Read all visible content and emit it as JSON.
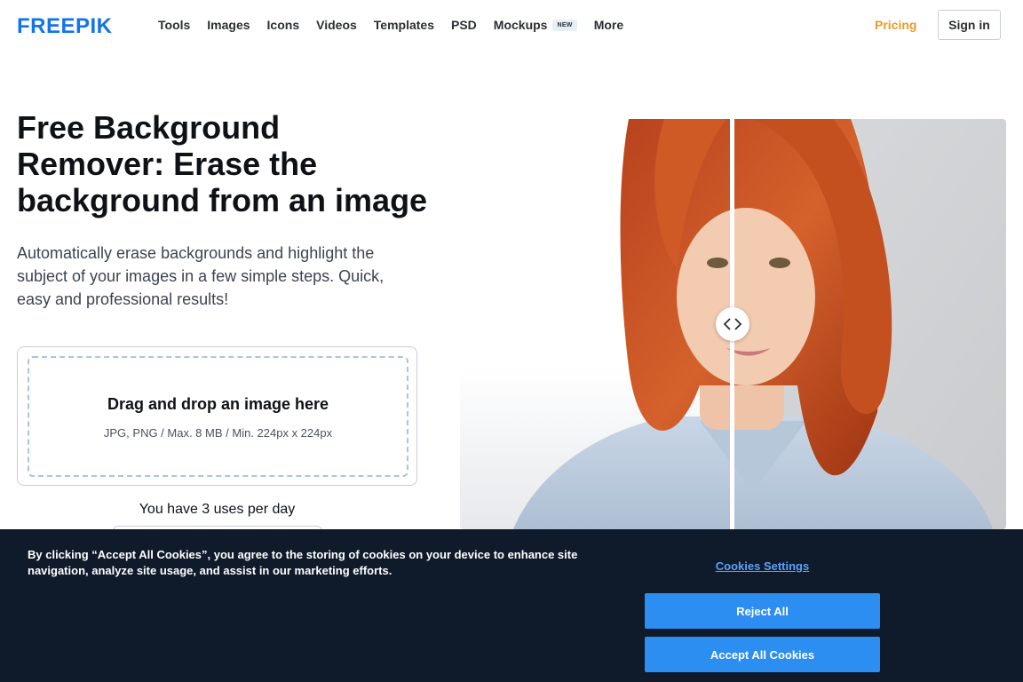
{
  "header": {
    "logo_text": "FREEPIK",
    "nav": [
      "Tools",
      "Images",
      "Icons",
      "Videos",
      "Templates",
      "PSD"
    ],
    "mockups_label": "Mockups",
    "new_badge": "NEW",
    "more_label": "More",
    "pricing_label": "Pricing",
    "signin_label": "Sign in"
  },
  "hero": {
    "title": "Free Background Remover: Erase the background from an image",
    "description": "Automatically erase backgrounds and highlight the subject of your images in a few simple steps. Quick, easy and professional results!"
  },
  "upload": {
    "title": "Drag and drop an image here",
    "hint": "JPG, PNG / Max. 8 MB / Min. 224px x 224px",
    "uses": "You have 3 uses per day"
  },
  "comparison": {
    "left_icon": "chevron-left-icon",
    "right_icon": "chevron-right-icon"
  },
  "cookie": {
    "text": "By clicking “Accept All Cookies”, you agree to the storing of cookies on your device to enhance site navigation, analyze site usage, and assist in our marketing efforts.",
    "settings_label": "Cookies Settings",
    "reject_label": "Reject All",
    "accept_label": "Accept All Cookies"
  },
  "colors": {
    "brand_blue": "#1273eb",
    "pricing_orange": "#e89b2a",
    "cookie_bg": "#0f1a2b",
    "cookie_button": "#2d8ef2"
  }
}
